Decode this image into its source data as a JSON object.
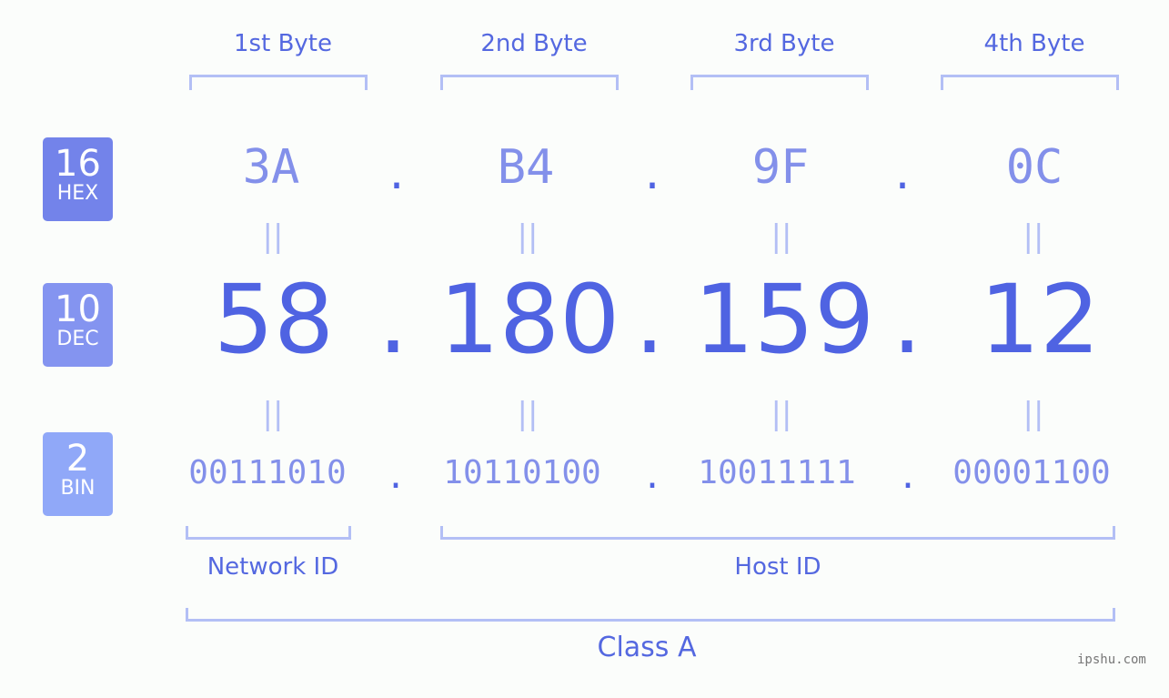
{
  "headers": [
    "1st Byte",
    "2nd Byte",
    "3rd Byte",
    "4th Byte"
  ],
  "badges": [
    {
      "number": "16",
      "label": "HEX",
      "color": "#7383ea"
    },
    {
      "number": "10",
      "label": "DEC",
      "color": "#8494f0"
    },
    {
      "number": "2",
      "label": "BIN",
      "color": "#90a8f8"
    }
  ],
  "hex": [
    "3A",
    "B4",
    "9F",
    "0C"
  ],
  "dec": [
    "58",
    "180",
    "159",
    "12"
  ],
  "bin": [
    "00111010",
    "10110100",
    "10011111",
    "00001100"
  ],
  "separator": ".",
  "equals": "||",
  "network_label": "Network ID",
  "host_label": "Host ID",
  "class_label": "Class A",
  "watermark": "ipshu.com"
}
